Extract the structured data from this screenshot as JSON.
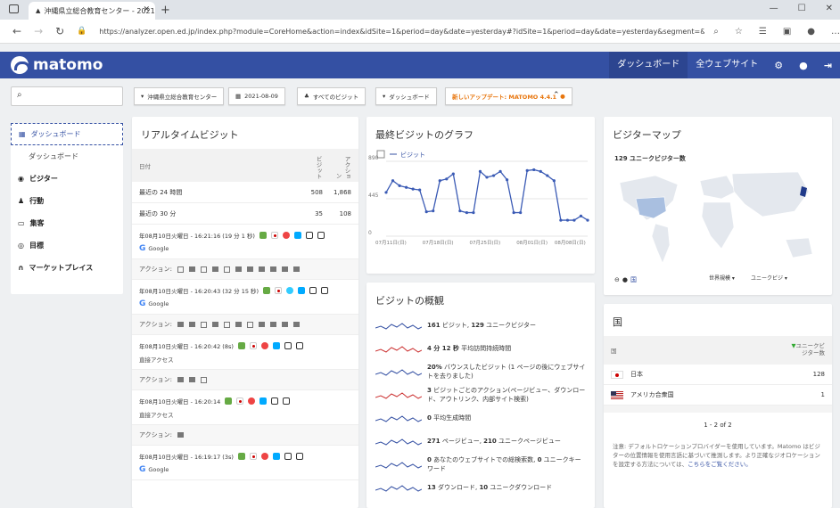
{
  "browser": {
    "tab_title": "沖縄県立総合教育センター - 2021",
    "tab_close": "✕",
    "new_tab": "+",
    "url": "https://analyzer.open.ed.jp/index.php?module=CoreHome&action=index&idSite=1&period=day&date=yesterday#?idSite=1&period=day&date=yesterday&segment=&category=Dashb...",
    "win_min": "—",
    "win_max": "☐",
    "win_close": "✕"
  },
  "topnav": {
    "brand": "matomo",
    "dashboard": "ダッシュボード",
    "all_websites": "全ウェブサイト"
  },
  "subbar": {
    "site": "沖縄県立総合教育センター",
    "date": "2021-08-09",
    "segment": "すべてのビジット",
    "dashboard": "ダッシュボード",
    "update": "新しいアップデート: MATOMO 4.4.1"
  },
  "leftnav": {
    "items": [
      {
        "label": "ダッシュボード"
      },
      {
        "label": "ダッシュボード"
      },
      {
        "label": "ビジター"
      },
      {
        "label": "行動"
      },
      {
        "label": "集客"
      },
      {
        "label": "目標"
      },
      {
        "label": "マーケットプレイス"
      }
    ]
  },
  "realtime": {
    "title": "リアルタイムビジット",
    "col_date": "日付",
    "col_visits": "ビジット",
    "col_actions": "アクション",
    "rows": [
      {
        "label": "最近の 24 時間",
        "visits": "508",
        "actions": "1,868"
      },
      {
        "label": "最近の 30 分",
        "visits": "35",
        "actions": "108"
      }
    ],
    "visits": [
      {
        "time": "年08月10日火曜日 - 16:21:16 (19 分 1 秒)",
        "source": "Google",
        "actions_label": "アクション:"
      },
      {
        "time": "年08月10日火曜日 - 16:20:43 (32 分 15 秒)",
        "source": "Google",
        "actions_label": "アクション:"
      },
      {
        "time": "年08月10日火曜日 - 16:20:42 (8s)",
        "source": "直接アクセス",
        "actions_label": "アクション:"
      },
      {
        "time": "年08月10日火曜日 - 16:20:14",
        "source": "直接アクセス",
        "actions_label": "アクション:"
      },
      {
        "time": "年08月10日火曜日 - 16:19:17 (3s)",
        "source": "Google",
        "actions_label": ""
      }
    ]
  },
  "graph": {
    "title": "最終ビジットのグラフ",
    "legend": "ビジット"
  },
  "chart_data": {
    "type": "line",
    "title": "最終ビジットのグラフ",
    "series": [
      {
        "name": "ビジット",
        "values": [
          520,
          660,
          600,
          580,
          560,
          550,
          290,
          300,
          660,
          680,
          740,
          300,
          280,
          280,
          770,
          700,
          720,
          770,
          670,
          280,
          280,
          780,
          790,
          770,
          720,
          660,
          190,
          190,
          190,
          240,
          190
        ]
      }
    ],
    "x_tick_labels": [
      "07月11日(日)",
      "07月18日(日)",
      "07月25日(日)",
      "08月01日(日)",
      "08月08日(日)"
    ],
    "y_tick_labels": [
      "890",
      "445",
      "0"
    ],
    "ylim": [
      0,
      890
    ]
  },
  "overview": {
    "title": "ビジットの概観",
    "items": [
      {
        "bold": "161",
        "text": " ビジット, ",
        "bold2": "129",
        "text2": " ユニークビジター"
      },
      {
        "bold": "4 分 12 秒",
        "text": " 平均訪問持続時間",
        "bold2": "",
        "text2": ""
      },
      {
        "bold": "20%",
        "text": " バウンスしたビジット (1 ページの後にウェブサイトを去りました)",
        "bold2": "",
        "text2": ""
      },
      {
        "bold": "3",
        "text": " ビジットごとのアクション(ページビュー、ダウンロード、アウトリンク、内部サイト検索)",
        "bold2": "",
        "text2": ""
      },
      {
        "bold": "0",
        "text": " 平均生成時間",
        "bold2": "",
        "text2": ""
      },
      {
        "bold": "271",
        "text": " ページビュー, ",
        "bold2": "210",
        "text2": " ユニークページビュー"
      },
      {
        "bold": "0",
        "text": " あなたのウェブサイトでの総検索数, ",
        "bold2": "0",
        "text2": " ユニークキーワード"
      },
      {
        "bold": "13",
        "text": " ダウンロード, ",
        "bold2": "10",
        "text2": " ユニークダウンロード"
      }
    ]
  },
  "map": {
    "title": "ビジターマップ",
    "unique_label": "129 ユニークビジター数",
    "region_select": "世界規模",
    "metric_select": "ユニークビジ",
    "zoom_link": "国"
  },
  "country": {
    "title": "国",
    "col_country": "国",
    "col_metric": "ユニークビジター数",
    "rows": [
      {
        "name": "日本",
        "value": "128"
      },
      {
        "name": "アメリカ合衆国",
        "value": "1"
      }
    ],
    "pagination": "1 - 2 of 2",
    "note": "注意: デフォルトロケーションプロバイダーを使用しています。Matomo はビジターの位置情報を使用言語に基づいて推測します。より正確なジオロケーションを設定する方法については、",
    "note_link": "こちらをご覧ください。"
  }
}
